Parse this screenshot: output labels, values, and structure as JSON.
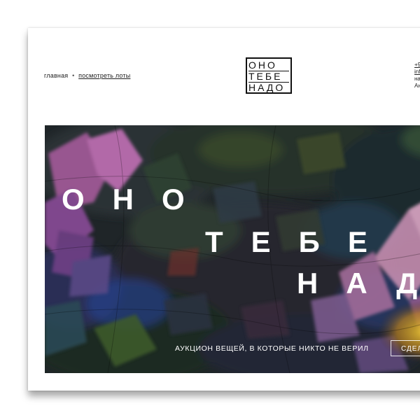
{
  "breadcrumb": {
    "home": "главная",
    "separator": "•",
    "current": "посмотреть лоты"
  },
  "logo": {
    "line1": "ОНО",
    "line2": "ТЕБЕ",
    "line3": "НАДО"
  },
  "contacts": {
    "phone": "+9",
    "email": "inf",
    "line3": "на",
    "line4": "Ан"
  },
  "hero": {
    "headline_1": "ОНО",
    "headline_2": "ТЕБЕ",
    "headline_3": "НАД",
    "tagline": "АУКЦИОН ВЕЩЕЙ, В КОТОРЫЕ НИКТО НЕ ВЕРИЛ",
    "cta_label": "СДЕЛ"
  },
  "colors": {
    "card_bg": "#ffffff",
    "hero_base": "#1d2326",
    "text_dark": "#222222",
    "text_light": "#ffffff"
  }
}
